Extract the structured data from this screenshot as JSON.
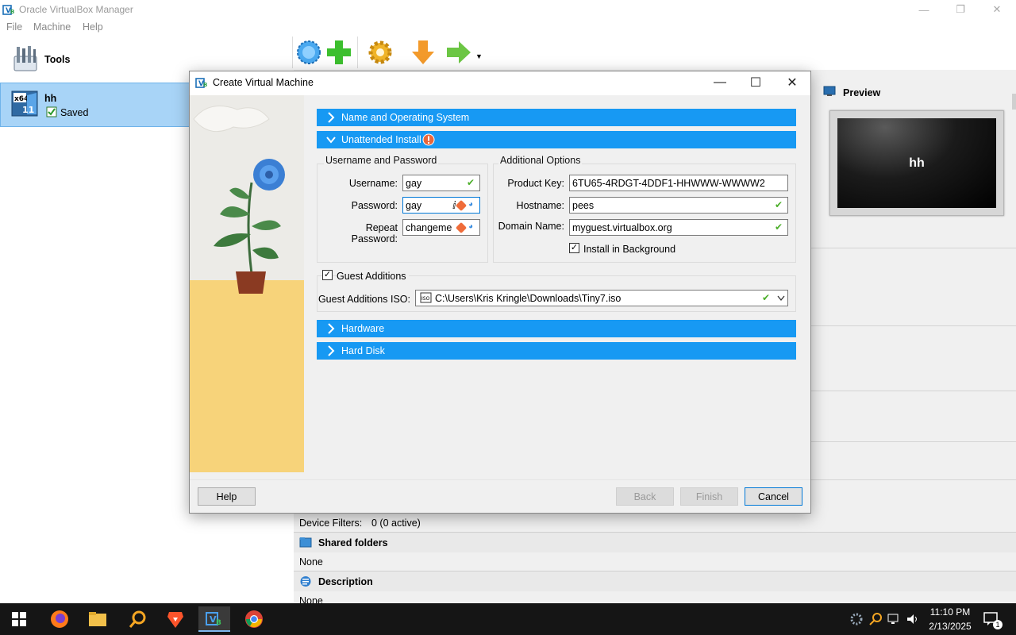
{
  "window": {
    "title": "Oracle VirtualBox Manager"
  },
  "menu": [
    "File",
    "Machine",
    "Help"
  ],
  "sidebar": {
    "tools_label": "Tools",
    "vm": {
      "name": "hh",
      "state": "Saved",
      "os_badge": "x64",
      "os_version": "11"
    }
  },
  "toolbar": {
    "items": [
      "new-icon",
      "add-icon",
      "settings-icon",
      "discard-icon",
      "start-icon"
    ]
  },
  "preview": {
    "label": "Preview",
    "screen_text": "hh"
  },
  "details": {
    "device_filters_label": "Device Filters:",
    "device_filters_value": "0 (0 active)",
    "shared_folders_title": "Shared folders",
    "shared_folders_value": "None",
    "description_title": "Description",
    "description_value": "None"
  },
  "dialog": {
    "title": "Create Virtual Machine",
    "sections": {
      "name_os": "Name and Operating System",
      "unattended": "Unattended Install",
      "hardware": "Hardware",
      "hard_disk": "Hard Disk"
    },
    "user_group": {
      "title": "Username and Password",
      "username_label": "Username:",
      "username_value": "gay",
      "password_label": "Password:",
      "password_value": "gay",
      "repeat_label": "Repeat Password:",
      "repeat_value": "changeme"
    },
    "options_group": {
      "title": "Additional Options",
      "product_key_label": "Product Key:",
      "product_key_value": "6TU65-4RDGT-4DDF1-HHWWW-WWWW2",
      "hostname_label": "Hostname:",
      "hostname_value": "pees",
      "domain_label": "Domain Name:",
      "domain_value": "myguest.virtualbox.org",
      "install_bg_label": "Install in Background"
    },
    "guest_additions": {
      "label": "Guest Additions",
      "iso_label": "Guest Additions ISO:",
      "iso_value": "C:\\Users\\Kris Kringle\\Downloads\\Tiny7.iso"
    },
    "buttons": {
      "help": "Help",
      "back": "Back",
      "finish": "Finish",
      "cancel": "Cancel"
    }
  },
  "taskbar": {
    "apps": [
      "windows-start-icon",
      "firefox-icon",
      "file-explorer-icon",
      "search-app-icon",
      "brave-icon",
      "virtualbox-icon",
      "chrome-icon"
    ],
    "time": "11:10 PM",
    "date": "2/13/2025",
    "notification_count": "1"
  }
}
